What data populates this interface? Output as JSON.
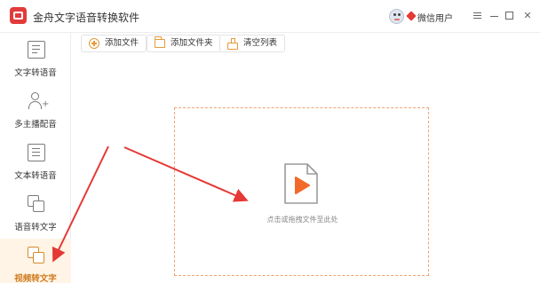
{
  "app": {
    "title": "金舟文字语音转换软件",
    "user_label": "微信用户",
    "icons": {
      "logo": "app-logo-icon",
      "avatar": "user-avatar",
      "user": "diamond-icon",
      "menu": "menu-icon",
      "minimize": "minimize-icon",
      "maximize": "maximize-icon",
      "close": "close-icon"
    },
    "close_glyph": "✕"
  },
  "sidebar": {
    "items": [
      {
        "label": "文字转语音",
        "icon": "text-to-speech-icon",
        "active": false
      },
      {
        "label": "多主播配音",
        "icon": "multi-voice-icon",
        "active": false
      },
      {
        "label": "文本转语音",
        "icon": "document-to-speech-icon",
        "active": false
      },
      {
        "label": "语音转文字",
        "icon": "speech-to-text-icon",
        "active": false
      },
      {
        "label": "视频转文字",
        "icon": "video-to-text-icon",
        "active": true
      }
    ]
  },
  "toolbar": {
    "add_file": "添加文件",
    "add_folder": "添加文件夹",
    "clear_list": "清空列表"
  },
  "dropzone": {
    "hint": "点击或拖拽文件至此处",
    "icon": "video-file-icon"
  },
  "colors": {
    "accent": "#e59a3a",
    "play": "#f26a2b",
    "annotation_arrow": "#e53935",
    "logo": "#e23b3b"
  }
}
